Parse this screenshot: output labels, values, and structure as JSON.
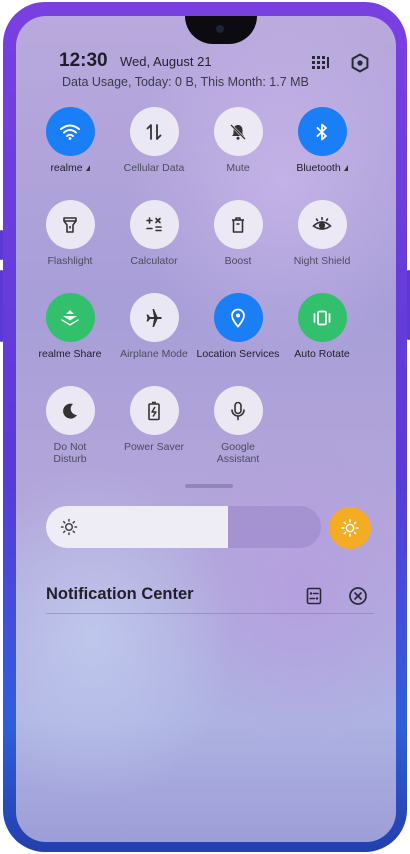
{
  "status": {
    "time": "12:30",
    "date": "Wed, August 21",
    "data_usage": "Data Usage, Today: 0 B, This Month: 1.7 MB"
  },
  "header_icons": [
    "grid-edit-icon",
    "settings-icon"
  ],
  "tiles": [
    {
      "label": "realme",
      "icon": "wifi-icon",
      "active": true,
      "color": "#1a7ef6",
      "caret": true
    },
    {
      "label": "Cellular Data",
      "icon": "cellular-data-icon",
      "active": false,
      "caret": false
    },
    {
      "label": "Mute",
      "icon": "bell-off-icon",
      "active": false,
      "caret": false
    },
    {
      "label": "Bluetooth",
      "icon": "bluetooth-icon",
      "active": true,
      "color": "#1a7ef6",
      "caret": true
    },
    {
      "label": "Flashlight",
      "icon": "flashlight-icon",
      "active": false
    },
    {
      "label": "Calculator",
      "icon": "calculator-icon",
      "active": false
    },
    {
      "label": "Boost",
      "icon": "trash-icon",
      "active": false
    },
    {
      "label": "Night Shield",
      "icon": "eye-icon",
      "active": false
    },
    {
      "label": "realme Share",
      "icon": "share-icon",
      "active": true,
      "color": "#33c06c"
    },
    {
      "label": "Airplane Mode",
      "icon": "airplane-icon",
      "active": false
    },
    {
      "label": "Location Services",
      "icon": "location-icon",
      "active": true,
      "color": "#1a7ef6"
    },
    {
      "label": "Auto Rotate",
      "icon": "rotate-icon",
      "active": true,
      "color": "#33c06c"
    },
    {
      "label": "Do Not Disturb",
      "icon": "moon-icon",
      "active": false
    },
    {
      "label": "Power Saver",
      "icon": "battery-icon",
      "active": false
    },
    {
      "label": "Google Assistant",
      "icon": "microphone-icon",
      "active": false
    }
  ],
  "brightness": {
    "level": 0.66,
    "auto_color": "#f4ac25"
  },
  "notification_center": {
    "title": "Notification Center"
  }
}
